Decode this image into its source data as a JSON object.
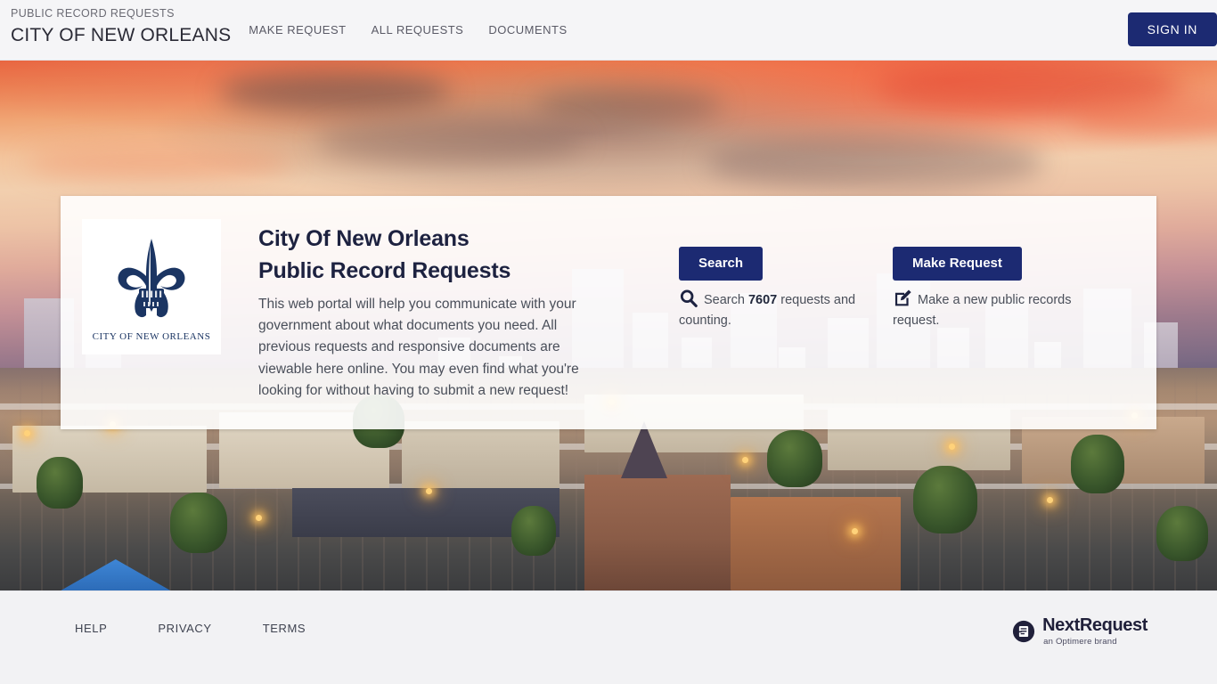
{
  "header": {
    "eyebrow": "PUBLIC RECORD REQUESTS",
    "org_title": "CITY OF NEW ORLEANS",
    "nav": [
      {
        "label": "MAKE REQUEST",
        "name": "nav-make-request"
      },
      {
        "label": "ALL REQUESTS",
        "name": "nav-all-requests"
      },
      {
        "label": "DOCUMENTS",
        "name": "nav-documents"
      }
    ],
    "sign_in_label": "SIGN IN"
  },
  "hero": {
    "logo_caption": "CITY OF NEW ORLEANS",
    "title_line1": "City Of New Orleans",
    "title_line2": "Public Record Requests",
    "description": "This web portal will help you communicate with your government about what documents you need. All previous requests and responsive documents are viewable here online. You may even find what you're looking for without having to submit a new request!",
    "search": {
      "button_label": "Search",
      "icon": "search-icon",
      "note_prefix": "Search ",
      "count": "7607",
      "note_suffix": " requests and counting."
    },
    "make_request": {
      "button_label": "Make Request",
      "icon": "edit-square-icon",
      "note": "Make a new public records request."
    }
  },
  "footer": {
    "links": [
      {
        "label": "HELP",
        "name": "footer-link-help"
      },
      {
        "label": "PRIVACY",
        "name": "footer-link-privacy"
      },
      {
        "label": "TERMS",
        "name": "footer-link-terms"
      }
    ],
    "vendor": {
      "name": "NextRequest",
      "tagline": "an Optimere brand",
      "icon": "nextrequest-mark-icon"
    }
  },
  "colors": {
    "brand_navy": "#1c2a72",
    "header_bg": "#f5f5f7",
    "footer_bg": "#f2f2f4",
    "heading_navy": "#1d2240",
    "body_text": "#4a4f5a",
    "logo_navy": "#1b3563"
  }
}
